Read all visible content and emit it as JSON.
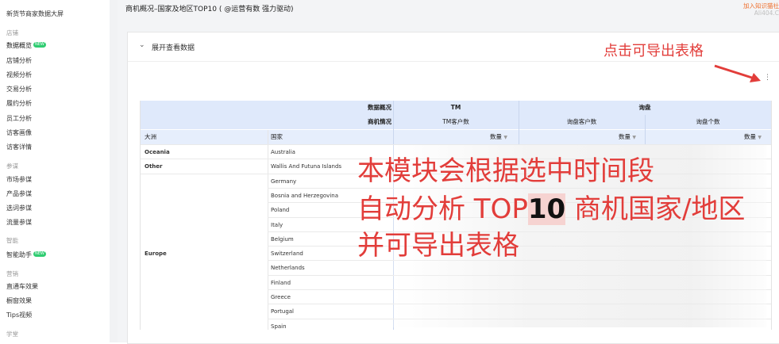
{
  "sidebar": {
    "items": [
      {
        "label": "新货节商家数据大屏",
        "type": "item"
      },
      {
        "label": "店铺",
        "type": "group"
      },
      {
        "label": "数据概览",
        "type": "item",
        "badge": "NEW",
        "active": true
      },
      {
        "label": "店铺分析",
        "type": "item"
      },
      {
        "label": "视频分析",
        "type": "item"
      },
      {
        "label": "交易分析",
        "type": "item"
      },
      {
        "label": "履约分析",
        "type": "item"
      },
      {
        "label": "员工分析",
        "type": "item"
      },
      {
        "label": "访客画像",
        "type": "item"
      },
      {
        "label": "访客详情",
        "type": "item"
      },
      {
        "label": "参谋",
        "type": "group"
      },
      {
        "label": "市场参谋",
        "type": "item"
      },
      {
        "label": "产品参谋",
        "type": "item"
      },
      {
        "label": "选词参谋",
        "type": "item"
      },
      {
        "label": "流量参谋",
        "type": "item"
      },
      {
        "label": "智能",
        "type": "group"
      },
      {
        "label": "智能助手",
        "type": "item",
        "badge": "NEW"
      },
      {
        "label": "营销",
        "type": "group"
      },
      {
        "label": "直通车效果",
        "type": "item"
      },
      {
        "label": "橱窗效果",
        "type": "item"
      },
      {
        "label": "Tips视频",
        "type": "item"
      },
      {
        "label": "学堂",
        "type": "group"
      }
    ]
  },
  "header": {
    "title": "商机概况–国家及地区TOP10 ( @运营有数 强力驱动)",
    "watermark_line1": "加入知识猫社",
    "watermark_line2": "Ali404.C"
  },
  "card": {
    "expand_label": "展开查看数据",
    "more_icon": "vertical-dots-icon"
  },
  "annotations": {
    "export_hint": "点击可导出表格",
    "line1": "本模块会根据选中时间段",
    "line2_pre": "自动分析 TOP",
    "line2_num": "10",
    "line2_post": " 商机国家/地区",
    "line3": "并可导出表格"
  },
  "table": {
    "row1_label": "数据概况",
    "row2_label": "商机情况",
    "group_tm": "TM",
    "group_inquiry": "询盘",
    "col_tm_customers": "TM客户数",
    "col_inquiry_customers": "询盘客户数",
    "col_inquiry_count": "询盘个数",
    "col_continent": "大洲",
    "col_country": "国家",
    "qty_label": "数量",
    "sort_icon": "sort-down-icon",
    "rows": [
      {
        "continent": "Oceania",
        "country": "Australia"
      },
      {
        "continent": "Other",
        "country": "Wallis And Futuna Islands"
      },
      {
        "continent": "",
        "country": "Germany"
      },
      {
        "continent": "",
        "country": "Bosnia and Herzegovina"
      },
      {
        "continent": "",
        "country": "Poland"
      },
      {
        "continent": "",
        "country": "Italy"
      },
      {
        "continent": "",
        "country": "Belgium"
      },
      {
        "continent": "Europe",
        "country": "Switzerland"
      },
      {
        "continent": "",
        "country": "Netherlands"
      },
      {
        "continent": "",
        "country": "Finland"
      },
      {
        "continent": "",
        "country": "Greece"
      },
      {
        "continent": "",
        "country": "Portugal"
      },
      {
        "continent": "",
        "country": "Spain"
      }
    ]
  },
  "colors": {
    "accent_red": "#e23d3a",
    "header_blue": "#dfe9fb",
    "badge_green": "#2fcc71"
  }
}
